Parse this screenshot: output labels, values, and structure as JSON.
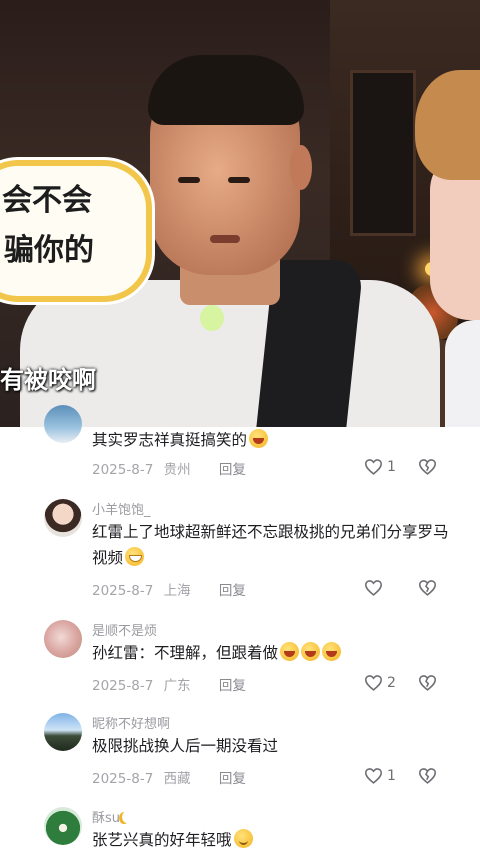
{
  "video": {
    "bubble_text_line1": "会不会",
    "bubble_text_line2": "骗你的",
    "subtitle": "有被咬啊"
  },
  "comments": [
    {
      "username": "",
      "text": "其实罗志祥真挺搞笑的",
      "emoji": "laughing-tears",
      "date": "2025-8-7",
      "location": "贵州",
      "reply_label": "回复",
      "likes": "1"
    },
    {
      "username": "小羊饱饱_",
      "text": "红雷上了地球超新鲜还不忘跟极挑的兄弟们分享罗马视频",
      "emoji": "grimace",
      "date": "2025-8-7",
      "location": "上海",
      "reply_label": "回复",
      "likes": ""
    },
    {
      "username": "是顺不是烦",
      "text": "孙红雷：不理解，但跟着做",
      "emoji": "laughing-x3",
      "date": "2025-8-7",
      "location": "广东",
      "reply_label": "回复",
      "likes": "2"
    },
    {
      "username": "昵称不好想啊",
      "text": "极限挑战换人后一期没看过",
      "date": "2025-8-7",
      "location": "西藏",
      "reply_label": "回复",
      "likes": "1"
    },
    {
      "username": "酥su",
      "username_emoji": "crescent-moon",
      "text": "张艺兴真的好年轻哦",
      "emoji": "smile"
    }
  ]
}
